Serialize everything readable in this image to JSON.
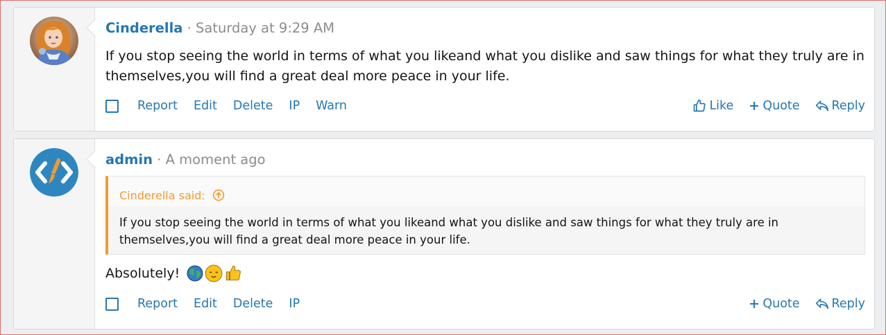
{
  "posts": [
    {
      "username": "Cinderella",
      "separator": "·",
      "time": "Saturday at 9:29 AM",
      "message": "If you stop seeing the world in terms of what you likeand what you dislike and saw things for what they truly are in themselves,you will find a great deal more peace in your life.",
      "actions": [
        "Report",
        "Edit",
        "Delete",
        "IP",
        "Warn"
      ],
      "right_actions": [
        "Like",
        "Quote",
        "Reply"
      ]
    },
    {
      "username": "admin",
      "separator": "·",
      "time": "A moment ago",
      "quote": {
        "author_said": "Cinderella said:",
        "text": "If you stop seeing the world in terms of what you likeand what you dislike and saw things for what they truly are in themselves,you will find a great deal more peace in your life."
      },
      "message": "Absolutely!",
      "emojis": [
        "earth-globe-icon",
        "relieved-face-icon",
        "thumbs-up-icon"
      ],
      "actions": [
        "Report",
        "Edit",
        "Delete",
        "IP"
      ],
      "right_actions": [
        "Quote",
        "Reply"
      ]
    }
  ],
  "colors": {
    "link": "#2577b1",
    "muted": "#8c8c8c",
    "quote_accent": "#f39a2c"
  }
}
